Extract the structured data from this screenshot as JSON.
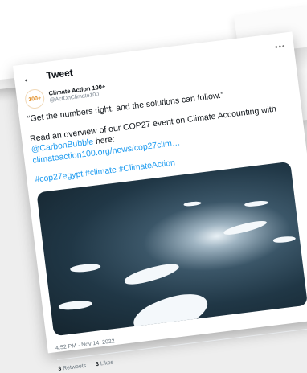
{
  "header": {
    "title": "Tweet",
    "back_icon": "arrow-left-icon",
    "more_icon": "more-horizontal-icon"
  },
  "author": {
    "name": "Climate Action 100+",
    "handle": "@ActOnClimate100",
    "avatar_text": "100+"
  },
  "tweet": {
    "quote": "“Get the numbers right, and the solutions can follow.”",
    "line_prefix": "Read an overview of our COP27 event on Climate Accounting with ",
    "mention": "@CarbonBubble",
    "line_suffix": " here:",
    "link": "climateaction100.org/news/cop27clim…",
    "hashtags": "#cop27egypt #climate #ClimateAction"
  },
  "meta": {
    "timestamp": "4:52 PM · Nov 14, 2022",
    "retweets_count": "3",
    "retweets_label": "Retweets",
    "likes_count": "3",
    "likes_label": "Likes"
  },
  "colors": {
    "link": "#1d9bf0",
    "text": "#0f1419",
    "secondary": "#6b7780"
  }
}
